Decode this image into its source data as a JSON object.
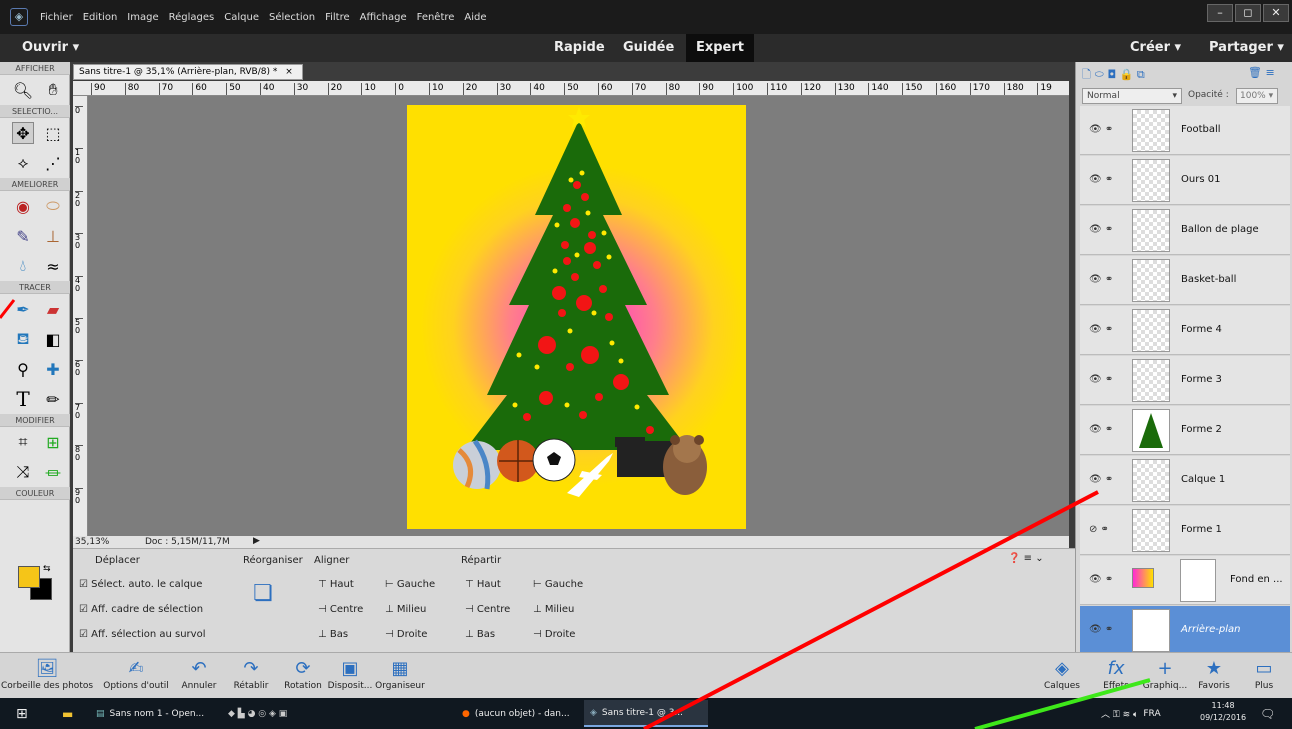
{
  "menubar": {
    "items": [
      "Fichier",
      "Edition",
      "Image",
      "Réglages",
      "Calque",
      "Sélection",
      "Filtre",
      "Affichage",
      "Fenêtre",
      "Aide"
    ]
  },
  "modebar": {
    "open": "Ouvrir",
    "modes": [
      "Rapide",
      "Guidée",
      "Expert"
    ],
    "active_mode": "Expert",
    "create": "Créer",
    "share": "Partager"
  },
  "toolbox": {
    "sections": {
      "view": "AFFICHER",
      "select": "SELECTIO...",
      "enhance": "AMELIORER",
      "draw": "TRACER",
      "modify": "MODIFIER",
      "color": "COULEUR"
    },
    "foreground_color": "#f5c518",
    "background_color": "#000000"
  },
  "document": {
    "tab_title": "Sans titre-1 @ 35,1% (Arrière-plan, RVB/8) *",
    "close_symbol": "×",
    "zoom": "35,13%",
    "doc_info": "Doc : 5,15M/11,7M"
  },
  "ruler": {
    "h": [
      "90",
      "80",
      "70",
      "60",
      "50",
      "40",
      "30",
      "20",
      "10",
      "0",
      "10",
      "20",
      "30",
      "40",
      "50",
      "60",
      "70",
      "80",
      "90",
      "100",
      "110",
      "120",
      "130",
      "140",
      "150",
      "160",
      "170",
      "180",
      "19"
    ],
    "v": [
      "0",
      "1 0",
      "2 0",
      "3 0",
      "4 0",
      "5 0",
      "6 0",
      "7 0",
      "8 0",
      "9 0"
    ]
  },
  "options": {
    "move_title": "Déplacer",
    "checkboxes": [
      "Sélect. auto. le calque",
      "Aff. cadre de sélection",
      "Aff. sélection au survol"
    ],
    "arrange_title": "Réorganiser",
    "align_title": "Aligner",
    "align": [
      "Haut",
      "Gauche",
      "Centre",
      "Milieu",
      "Bas",
      "Droite"
    ],
    "distribute_title": "Répartir",
    "distribute": [
      "Haut",
      "Gauche",
      "Centre",
      "Milieu",
      "Bas",
      "Droite"
    ]
  },
  "layers_panel": {
    "blend_mode": "Normal",
    "opacity_label": "Opacité :",
    "opacity": "100%",
    "layers": [
      {
        "name": "Football",
        "visible": true
      },
      {
        "name": "Ours 01",
        "visible": true
      },
      {
        "name": "Ballon de plage",
        "visible": true
      },
      {
        "name": "Basket-ball",
        "visible": true
      },
      {
        "name": "Forme 4",
        "visible": true
      },
      {
        "name": "Forme 3",
        "visible": true
      },
      {
        "name": "Forme 2",
        "visible": true
      },
      {
        "name": "Calque 1",
        "visible": true
      },
      {
        "name": "Forme 1",
        "visible": false
      },
      {
        "name": "Fond en ...",
        "visible": true
      },
      {
        "name": "Arrière-plan",
        "visible": true
      }
    ]
  },
  "bottombar": {
    "left": [
      "Corbeille des photos",
      "Options d'outil",
      "Annuler",
      "Rétablir",
      "Rotation",
      "Disposit...",
      "Organiseur"
    ],
    "right": [
      "Calques",
      "Effets",
      "Graphiq...",
      "Favoris",
      "Plus"
    ]
  },
  "taskbar": {
    "tasks": [
      "Sans nom 1 - Open...",
      "(aucun objet) - dan...",
      "Sans titre-1 @ 3..."
    ],
    "language": "FRA",
    "time": "11:48",
    "date": "09/12/2016"
  },
  "colors": {
    "accent_blue": "#5b8fd6",
    "tree": "#1a6b0a",
    "ornament": "#f21515",
    "star": "#ffea00",
    "annotation_red": "#ff0000",
    "annotation_green": "#3ee81a"
  }
}
